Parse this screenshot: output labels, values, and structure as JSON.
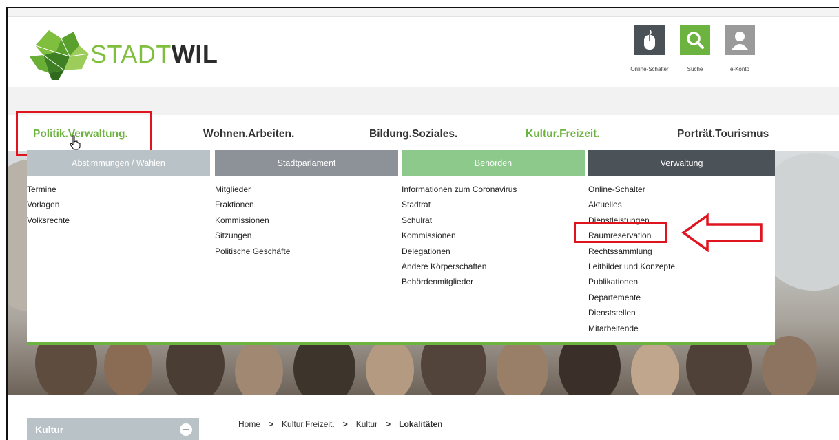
{
  "header": {
    "logo": {
      "word1": "STADT",
      "word2": "WIL"
    },
    "tools": [
      {
        "label": "Online-Schalter",
        "icon": "mouse-icon",
        "color": "#4a5157"
      },
      {
        "label": "Suche",
        "icon": "search-icon",
        "color": "#6cb33f"
      },
      {
        "label": "e-Konto",
        "icon": "user-icon",
        "color": "#9a9a9a"
      }
    ]
  },
  "nav": {
    "items": [
      {
        "label": "Politik.Verwaltung."
      },
      {
        "label": "Wohnen.Arbeiten."
      },
      {
        "label": "Bildung.Soziales."
      },
      {
        "label": "Kultur.Freizeit."
      },
      {
        "label": "Porträt.Tourismus"
      }
    ]
  },
  "mega": {
    "columns": [
      {
        "title": "Abstimmungen / Wahlen",
        "color": "#b9c2c7",
        "links": [
          "Termine",
          "Vorlagen",
          "Volksrechte"
        ]
      },
      {
        "title": "Stadtparlament",
        "color": "#8c9297",
        "links": [
          "Mitglieder",
          "Fraktionen",
          "Kommissionen",
          "Sitzungen",
          "Politische Geschäfte"
        ]
      },
      {
        "title": "Behörden",
        "color": "#8cc98a",
        "links": [
          "Informationen zum Coronavirus",
          "Stadtrat",
          "Schulrat",
          "Kommissionen",
          "Delegationen",
          "Andere Körperschaften",
          "Behördenmitglieder"
        ]
      },
      {
        "title": "Verwaltung",
        "color": "#4b5258",
        "links": [
          "Online-Schalter",
          "Aktuelles",
          "Dienstleistungen",
          "Raumreservation",
          "Rechtssammlung",
          "Leitbilder und Konzepte",
          "Publikationen",
          "Departemente",
          "Dienststellen",
          "Mitarbeitende"
        ]
      }
    ]
  },
  "sidebar": {
    "title": "Kultur"
  },
  "breadcrumb": {
    "items": [
      "Home",
      "Kultur.Freizeit.",
      "Kultur"
    ],
    "current": "Lokalitäten",
    "separator": ">"
  },
  "annotation": {
    "color": "#e0141e"
  }
}
